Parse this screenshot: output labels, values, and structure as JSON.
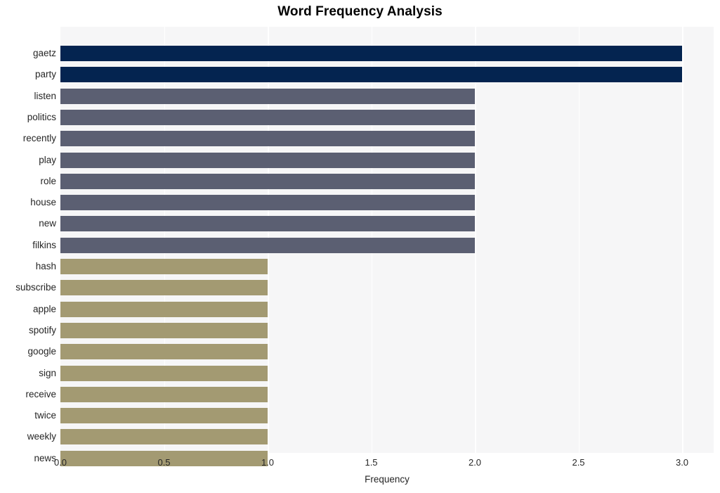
{
  "chart_data": {
    "type": "bar",
    "orientation": "horizontal",
    "title": "Word Frequency Analysis",
    "xlabel": "Frequency",
    "ylabel": "",
    "xlim": [
      0.0,
      3.0
    ],
    "xticks": [
      "0.0",
      "0.5",
      "1.0",
      "1.5",
      "2.0",
      "2.5",
      "3.0"
    ],
    "xtick_values": [
      0.0,
      0.5,
      1.0,
      1.5,
      2.0,
      2.5,
      3.0
    ],
    "grid": true,
    "grid_axis": "x",
    "legend": "none",
    "categories": [
      "gaetz",
      "party",
      "listen",
      "politics",
      "recently",
      "play",
      "role",
      "house",
      "new",
      "filkins",
      "hash",
      "subscribe",
      "apple",
      "spotify",
      "google",
      "sign",
      "receive",
      "twice",
      "weekly",
      "news"
    ],
    "values": [
      3,
      3,
      2,
      2,
      2,
      2,
      2,
      2,
      2,
      2,
      1,
      1,
      1,
      1,
      1,
      1,
      1,
      1,
      1,
      1
    ],
    "bar_colors": [
      "#042450",
      "#042450",
      "#5b5f72",
      "#5b5f72",
      "#5b5f72",
      "#5b5f72",
      "#5b5f72",
      "#5b5f72",
      "#5b5f72",
      "#5b5f72",
      "#a39a72",
      "#a39a72",
      "#a39a72",
      "#a39a72",
      "#a39a72",
      "#a39a72",
      "#a39a72",
      "#a39a72",
      "#a39a72",
      "#a39a72"
    ],
    "palette": {
      "high": "#042450",
      "mid": "#5b5f72",
      "low": "#a39a72",
      "plot_background": "#f6f6f7",
      "figure_background": "#ffffff",
      "gridline": "#ffffff",
      "text": "#262626"
    }
  }
}
